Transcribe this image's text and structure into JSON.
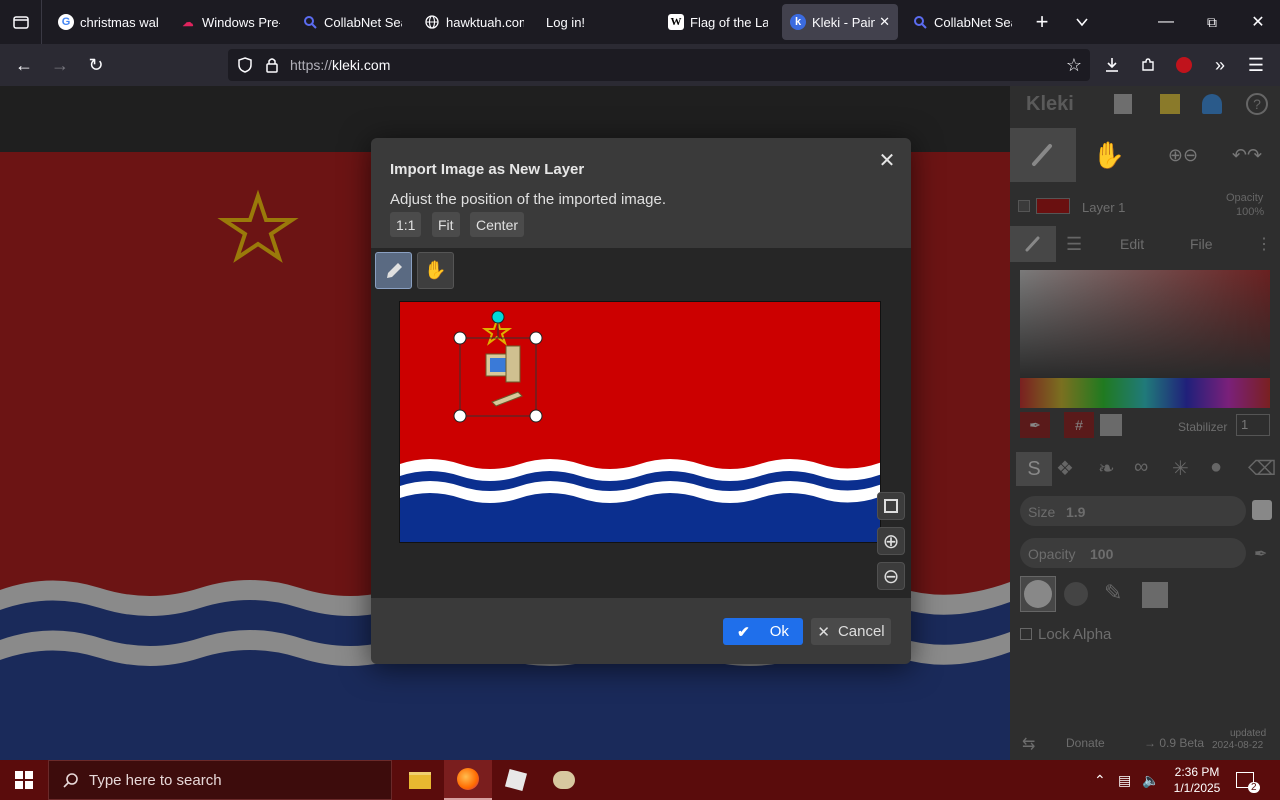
{
  "browser": {
    "tabs": [
      {
        "label": "christmas wall",
        "favicon": "google-icon",
        "active": false
      },
      {
        "label": "Windows Pre-r",
        "favicon": "windows-insider-icon",
        "active": false
      },
      {
        "label": "CollabNet Sear",
        "favicon": "search-icon",
        "active": false
      },
      {
        "label": "hawktuah.com",
        "favicon": "globe-icon",
        "active": false
      },
      {
        "label": "Log in!",
        "favicon": "",
        "active": false
      },
      {
        "label": "Flag of the Lat",
        "favicon": "wikipedia-icon",
        "active": false
      },
      {
        "label": "Kleki - Paint",
        "favicon": "kleki-icon",
        "active": true
      },
      {
        "label": "CollabNet Sear",
        "favicon": "search-icon",
        "active": false
      }
    ],
    "url_prefix": "https://",
    "url_host": "kleki.com"
  },
  "modal": {
    "title": "Import Image as New Layer",
    "description": "Adjust the position of the imported image.",
    "buttons": [
      "1:1",
      "Fit",
      "Center"
    ],
    "ok_label": "Ok",
    "cancel_label": "Cancel"
  },
  "right_panel": {
    "logo": "Kleki",
    "layer_name": "Layer 1",
    "opacity_label": "Opacity",
    "opacity_value": "100%",
    "tabs": [
      "Edit",
      "File"
    ],
    "stabilizer_label": "Stabilizer",
    "stabilizer_value": "1",
    "hex_label": "#",
    "size_label": "Size",
    "size_value": "1.9",
    "brush_opacity_label": "Opacity",
    "brush_opacity_value": "100",
    "lock_alpha_label": "Lock Alpha",
    "donate_label": "Donate",
    "version_label": "0.9 Beta",
    "updated_label": "updated",
    "updated_date": "2024-08-22"
  },
  "taskbar": {
    "search_placeholder": "Type here to search",
    "time": "2:36 PM",
    "date": "1/1/2025",
    "notification_count": "2"
  },
  "colors": {
    "flag_red": "#cc0000",
    "flag_blue": "#0b2f8f",
    "canvas_red": "#6c1414",
    "canvas_blue": "#1a2a5a",
    "accent_blue": "#1f6feb"
  }
}
